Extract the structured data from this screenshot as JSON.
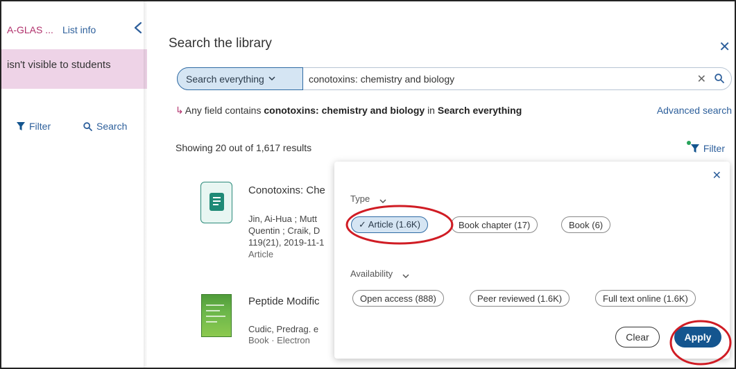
{
  "left": {
    "course_code": "A-GLAS ...",
    "list_info": "List info",
    "banner": "isn't visible to students",
    "filter_label": "Filter",
    "search_label": "Search"
  },
  "panel": {
    "title": "Search the library",
    "scope_label": "Search everything",
    "query": "conotoxins: chemistry and biology",
    "crumb": {
      "prefix": "Any field contains",
      "term": "conotoxins: chemistry and biology",
      "mid": "in",
      "scope": "Search everything"
    },
    "advanced_search": "Advanced search",
    "showing": "Showing 20 out of 1,617 results",
    "filter_label": "Filter"
  },
  "results": [
    {
      "title": "Conotoxins: Che",
      "meta_lines": [
        "Jin, Ai-Hua ; Mutt",
        "Quentin ; Craik, D",
        "119(21), 2019-11-1"
      ],
      "type": "Article"
    },
    {
      "title": "Peptide Modific",
      "meta_lines": [
        "Cudic, Predrag. e"
      ],
      "type": "Book · Electron"
    }
  ],
  "filter_popover": {
    "type_label": "Type",
    "type_options": [
      {
        "label": "✓ Article (1.6K)",
        "selected": true
      },
      {
        "label": "Book chapter (17)",
        "selected": false
      },
      {
        "label": "Book (6)",
        "selected": false
      }
    ],
    "availability_label": "Availability",
    "availability_options": [
      {
        "label": "Open access (888)",
        "selected": false
      },
      {
        "label": "Peer reviewed (1.6K)",
        "selected": false
      },
      {
        "label": "Full text online (1.6K)",
        "selected": false
      }
    ],
    "clear_label": "Clear",
    "apply_label": "Apply"
  },
  "colors": {
    "accent": "#14558f",
    "selected_chip": "#d5e5f3",
    "banner": "#eed3e7",
    "annotation": "#d01c24",
    "active_dot": "#27a35a"
  }
}
